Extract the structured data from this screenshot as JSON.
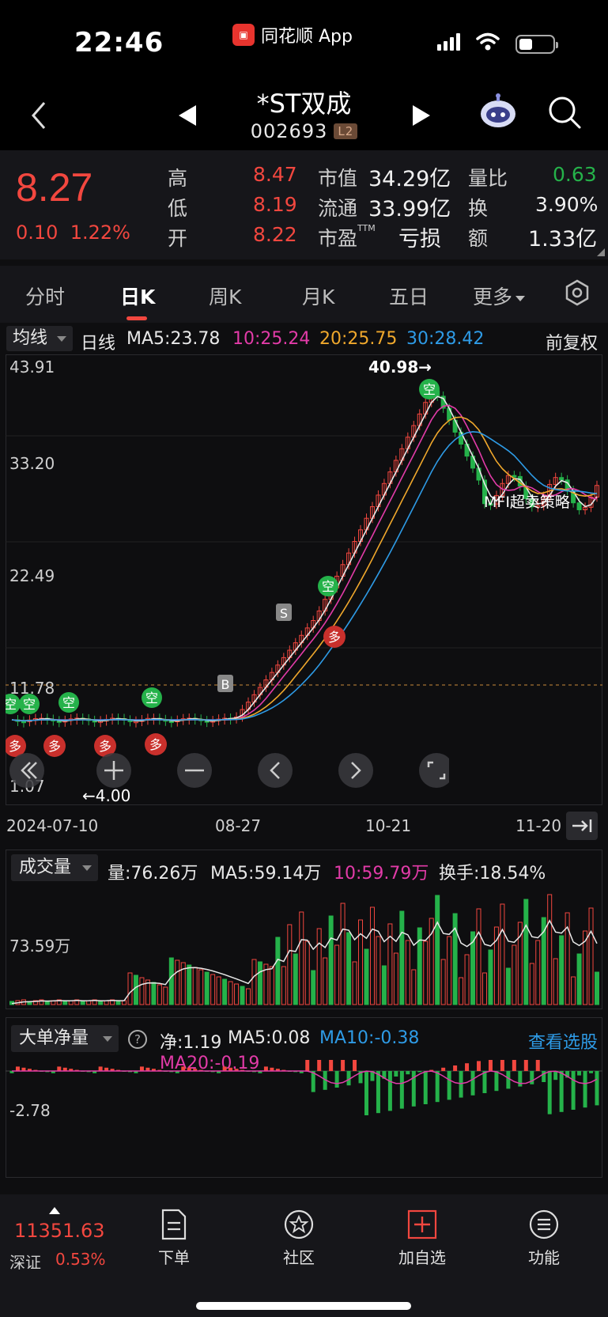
{
  "status": {
    "time": "22:46",
    "app_name": "同花顺 App"
  },
  "nav": {
    "stock_name": "*ST双成",
    "stock_code": "002693",
    "level_badge": "L2"
  },
  "quote": {
    "price": "8.27",
    "change": "0.10",
    "change_pct": "1.22%",
    "stats": [
      {
        "label": "高",
        "value": "8.47"
      },
      {
        "label": "低",
        "value": "8.19"
      },
      {
        "label": "开",
        "value": "8.22"
      },
      {
        "label": "市值",
        "value": "34.29亿"
      },
      {
        "label": "流通",
        "value": "33.99亿"
      },
      {
        "label": "市盈",
        "sup": "TTM",
        "value": "亏损"
      },
      {
        "label": "量比",
        "value": "0.63"
      },
      {
        "label": "换",
        "value": "3.90%"
      },
      {
        "label": "额",
        "value": "1.33亿"
      }
    ]
  },
  "tabs": [
    "分时",
    "日K",
    "周K",
    "月K",
    "五日",
    "更多"
  ],
  "ma_row": {
    "selector": "均线",
    "period": "日线",
    "ma5": "MA5:23.78",
    "ma10": "10:25.24",
    "ma20": "20:25.75",
    "ma30": "30:28.42",
    "adjust": "前复权"
  },
  "colors": {
    "up": "#f2473f",
    "down": "#25b24a",
    "ma5": "#e8e8e8",
    "ma10": "#e23ba8",
    "ma20": "#f0a82c",
    "ma30": "#2e9be6"
  },
  "kchart": {
    "y_labels": [
      "43.91",
      "33.20",
      "22.49",
      "11.78",
      "1.07"
    ],
    "x_labels": [
      "2024-07-10",
      "08-27",
      "10-21",
      "11-20"
    ],
    "high_marker": "40.98→",
    "low_marker": "←4.00",
    "strategy_label": "MFI超卖策略",
    "signals": {
      "short": "空",
      "long": "多",
      "buy": "B",
      "sell": "S"
    }
  },
  "volume": {
    "selector": "成交量",
    "vol": "量:76.26万",
    "ma5": "MA5:59.14万",
    "ma10": "10:59.79万",
    "turnover": "换手:18.54%",
    "y_label": "73.59万"
  },
  "flow": {
    "selector": "大单净量",
    "net": "净:1.19",
    "ma5": "MA5:0.08",
    "ma10": "MA10:-0.38",
    "ma20": "MA20:-0.19",
    "link": "查看选股",
    "y_label": "-2.78"
  },
  "bottom": {
    "index_value": "11351.63",
    "index_name": "深证",
    "index_pct": "0.53%",
    "items": [
      "下单",
      "社区",
      "加自选",
      "功能"
    ]
  }
}
